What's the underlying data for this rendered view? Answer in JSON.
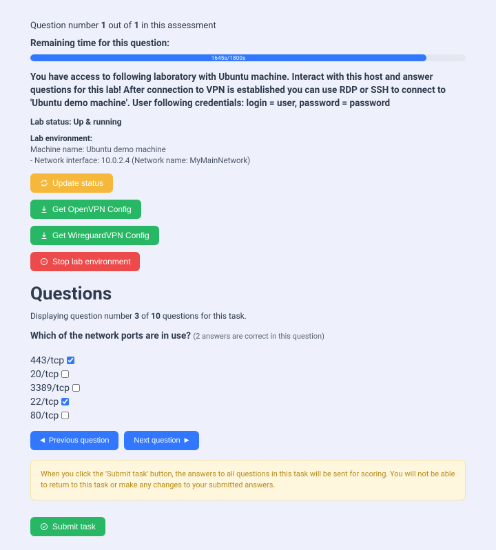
{
  "header": {
    "question_number_prefix": "Question number ",
    "question_number": "1",
    "question_number_mid": " out of ",
    "question_total": "1",
    "question_number_suffix": " in this assessment",
    "remaining_label": "Remaining time for this question:",
    "progress_text": "1645s/1800s",
    "progress_pct": 91
  },
  "instructions": "You have access to following laboratory with Ubuntu machine. Interact with this host and answer questions for this lab! After connection to VPN is established you can use RDP or SSH to connect to 'Ubuntu demo machine'. User following credentials: login = user, password = password",
  "lab": {
    "status_label": "Lab status: ",
    "status_value": "Up & running",
    "env_head": "Lab environment:",
    "machine_line": "Machine name: Ubuntu demo machine",
    "net_line": "- Network interface: 10.0.2.4 (Network name: MyMainNetwork)"
  },
  "buttons": {
    "update": "Update status",
    "openvpn": "Get OpenVPN Config",
    "wireguard": "Get WireguardVPN Config",
    "stop": "Stop lab environment",
    "prev": "Previous question",
    "next": "Next question",
    "submit": "Submit task"
  },
  "questions_heading": "Questions",
  "display_q": {
    "prefix": "Displaying question number ",
    "num": "3",
    "mid": " of ",
    "total": "10",
    "suffix": " questions for this task."
  },
  "question": {
    "text": "Which of the network ports are in use? ",
    "hint": "(2 answers are correct in this question)",
    "options": [
      {
        "label": "443/tcp",
        "checked": true
      },
      {
        "label": "20/tcp",
        "checked": false
      },
      {
        "label": "3389/tcp",
        "checked": false
      },
      {
        "label": "22/tcp",
        "checked": true
      },
      {
        "label": "80/tcp",
        "checked": false
      }
    ]
  },
  "warning": "When you click the 'Submit task' button, the answers to all questions in this task will be sent for scoring. You will not be able to return to this task or make any changes to your submitted answers."
}
